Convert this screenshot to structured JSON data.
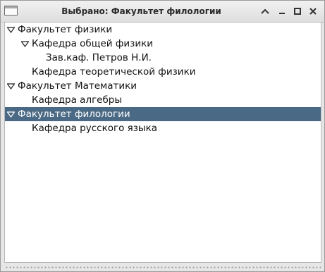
{
  "window": {
    "title": "Выбрано: Факультет филологии",
    "app_icon": "window-icon",
    "controls": [
      "up-arrow-icon",
      "minimize-icon",
      "maximize-icon",
      "close-icon"
    ]
  },
  "tree": {
    "rows": [
      {
        "label": "Факультет физики",
        "level": 0,
        "expanded": true,
        "selected": false
      },
      {
        "label": "Кафедра общей физики",
        "level": 1,
        "expanded": true,
        "selected": false
      },
      {
        "label": "Зав.каф. Петров Н.И.",
        "level": 2,
        "expanded": null,
        "selected": false
      },
      {
        "label": "Кафедра теоретической  физики",
        "level": 1,
        "expanded": null,
        "selected": false
      },
      {
        "label": "Факультет Математики",
        "level": 0,
        "expanded": true,
        "selected": false
      },
      {
        "label": "Кафедра алгебры",
        "level": 1,
        "expanded": null,
        "selected": false
      },
      {
        "label": "Факультет филологии",
        "level": 0,
        "expanded": true,
        "selected": true
      },
      {
        "label": "Кафедра русского языка",
        "level": 1,
        "expanded": null,
        "selected": false
      }
    ]
  },
  "colors": {
    "selection": "#4a6984",
    "selection_text": "#ffffff"
  }
}
